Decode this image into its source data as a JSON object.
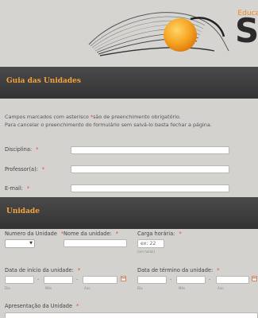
{
  "brand": {
    "partial_text": "Educa",
    "big_letters": "SU"
  },
  "section1": {
    "title": "Guia das Unidades"
  },
  "intro": {
    "line1_before": "Campos marcados com asterisco ",
    "line1_asterisk": "*",
    "line1_after": "são de preenchimento obrigatório.",
    "line2": "Para cancelar o preenchimento do formulário sem salvá-lo basta fechar a página."
  },
  "fields": {
    "disciplina_label": "Disciplina:",
    "professor_label": "Professor(a):",
    "email_label": "E-mail:",
    "required_mark": "*"
  },
  "section2": {
    "title": "Unidade"
  },
  "unidade": {
    "numero_label": "Numero da Unidade",
    "nome_label": "Nome da unidade:",
    "carga_label": "Carga horária:",
    "carga_placeholder": "ex: 22",
    "carga_hint": "(em horas)",
    "inicio_label": "Data de início da unidade:",
    "termino_label": "Data de término da unidade:",
    "dia_hint": "Dia",
    "mes_hint": "Mês",
    "ano_hint": "Ano",
    "date_sep": "-",
    "apresentacao_label": "Apresentação da Unidade",
    "select_arrow": "▼"
  },
  "colors": {
    "accent_orange": "#f4a23c",
    "required_red": "#e0483a",
    "sun": "#f5a623",
    "header_dark": "#333333"
  },
  "icons": {
    "calendar": "calendar-icon",
    "dropdown": "chevron-down-icon"
  }
}
